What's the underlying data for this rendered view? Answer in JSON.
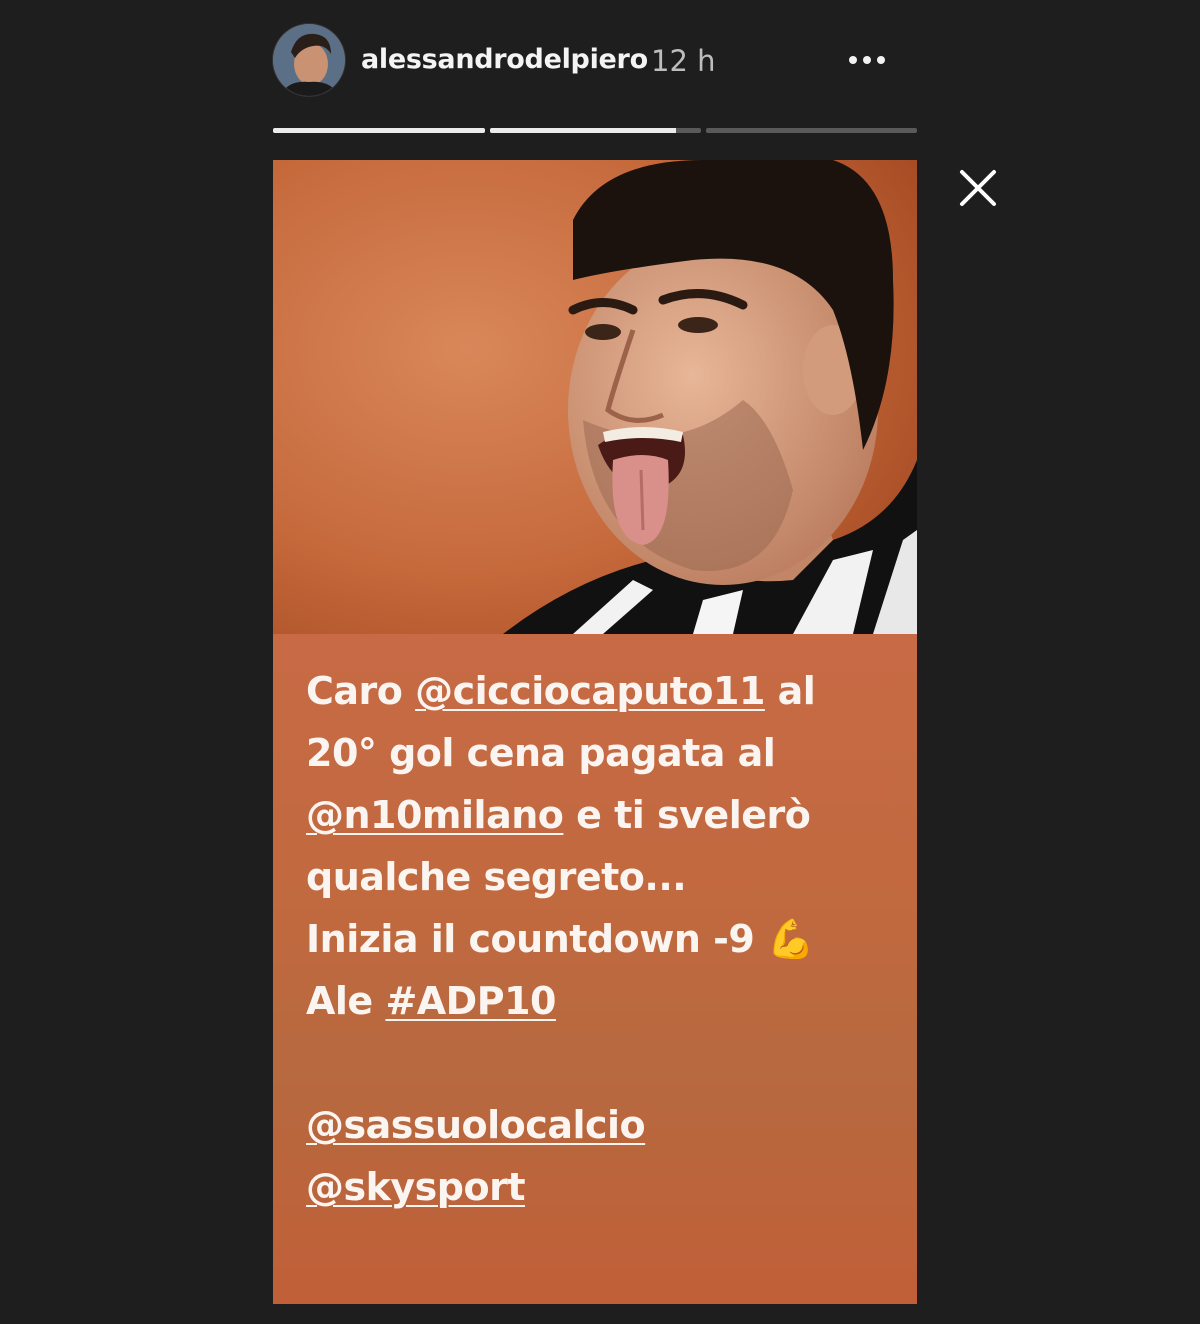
{
  "header": {
    "username": "alessandrodelpiero",
    "time": "12 h",
    "more_icon": "more-horizontal-icon"
  },
  "progress": {
    "segments": [
      {
        "fill": 1.0
      },
      {
        "fill": 0.88
      },
      {
        "fill": 0.0
      }
    ]
  },
  "close_icon": "close-icon",
  "caption": {
    "l1_a": "Caro ",
    "l1_mention": "@cicciocaputo11",
    "l1_b": " al",
    "l2": "20° gol cena pagata al",
    "l3_mention": "@n10milano",
    "l3_b": " e ti svelerò",
    "l4": "qualche segreto...",
    "l5": "Inizia il countdown -9 💪",
    "l6_a": "Ale ",
    "l6_hashtag": "#ADP10",
    "m1": "@sassuolocalcio",
    "m2": "@skysport"
  }
}
